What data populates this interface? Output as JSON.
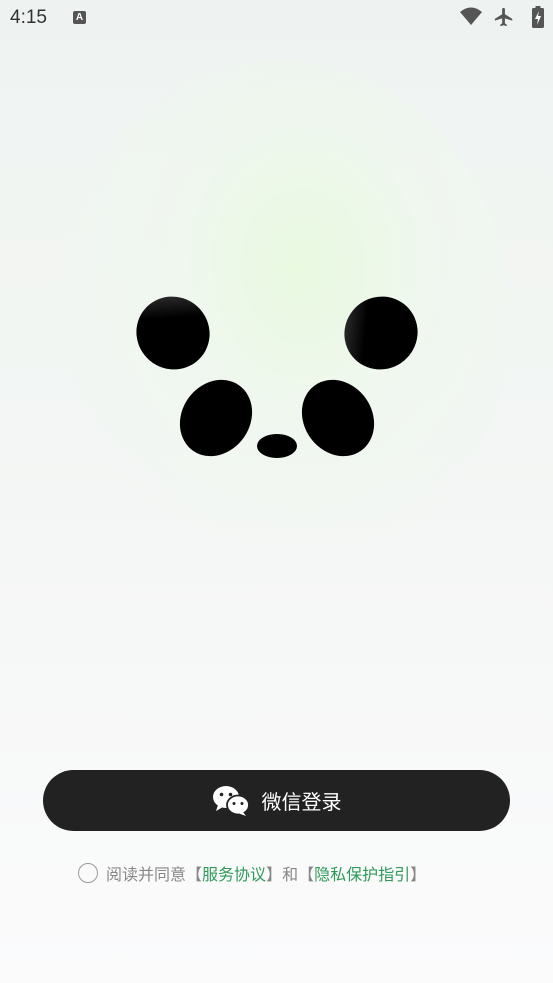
{
  "status_bar": {
    "time": "4:15",
    "notification_badge": "A",
    "icons": [
      "wifi-icon",
      "airplane-mode-icon",
      "battery-icon"
    ]
  },
  "logo": {
    "icon": "panda-face-icon",
    "color": "#000000"
  },
  "login": {
    "label": "微信登录",
    "icon": "wechat-icon",
    "background": "#222222"
  },
  "agreement": {
    "checked": false,
    "prefix": "阅读并同意",
    "service_link": "服务协议",
    "conjunction": "和",
    "privacy_link": "隐私保护指引",
    "bracket_open": "【",
    "bracket_close": "】",
    "link_color": "#2f9a5a"
  }
}
